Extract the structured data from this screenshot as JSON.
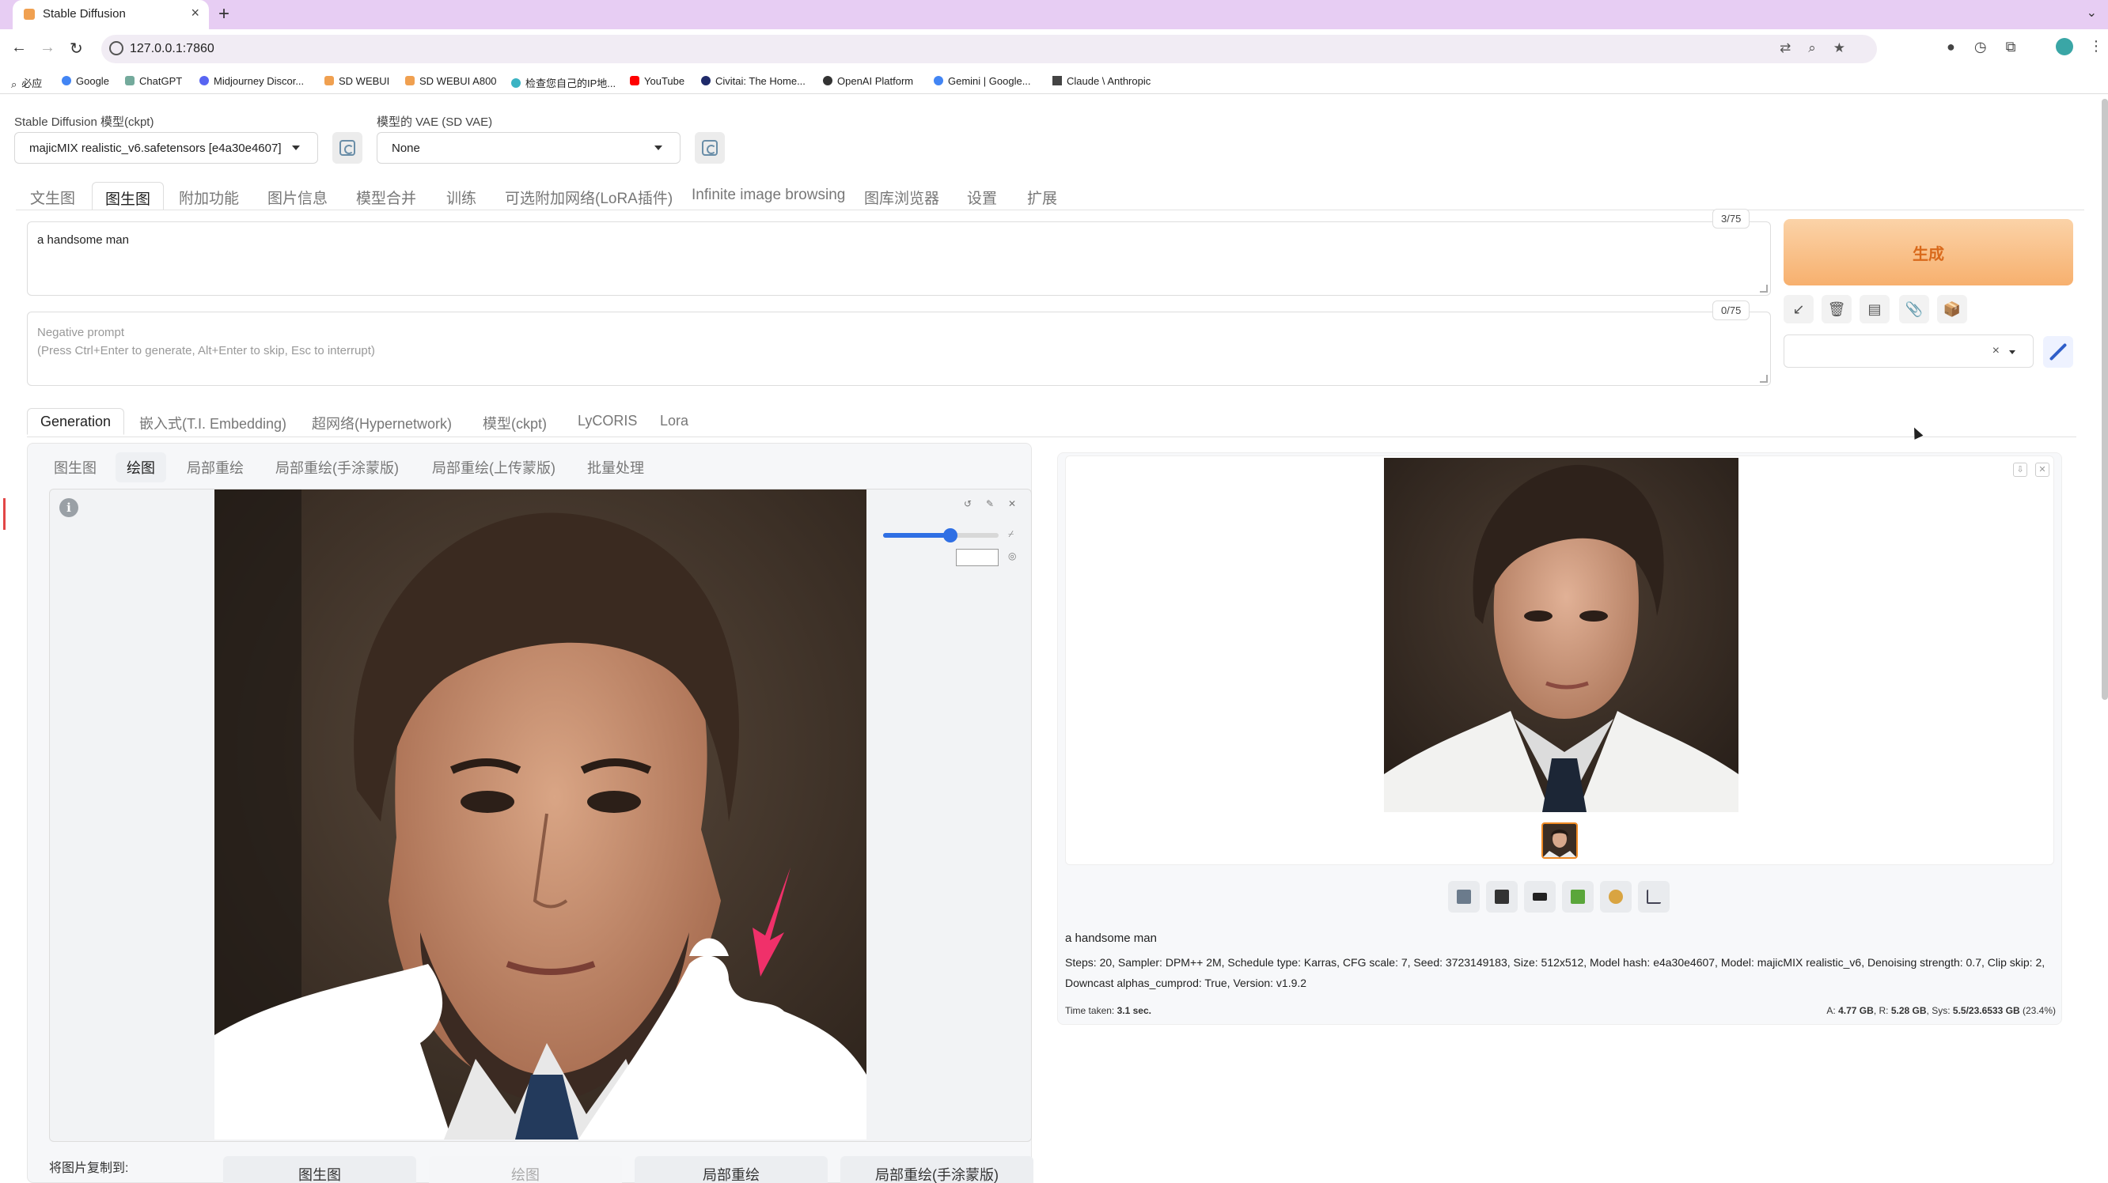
{
  "browser": {
    "tab_title": "Stable Diffusion",
    "url": "127.0.0.1:7860",
    "bookmarks": [
      "必应",
      "Google",
      "ChatGPT",
      "Midjourney Discor...",
      "SD WEBUI",
      "SD WEBUI A800",
      "检查您自己的IP地...",
      "YouTube",
      "Civitai: The Home...",
      "OpenAI Platform",
      "Gemini | Google...",
      "Claude \\ Anthropic"
    ]
  },
  "models": {
    "ckpt_label": "Stable Diffusion 模型(ckpt)",
    "ckpt_value": "majicMIX realistic_v6.safetensors [e4a30e4607]",
    "vae_label": "模型的 VAE (SD VAE)",
    "vae_value": "None"
  },
  "main_tabs": [
    "文生图",
    "图生图",
    "附加功能",
    "图片信息",
    "模型合并",
    "训练",
    "可选附加网络(LoRA插件)",
    "Infinite image browsing",
    "图库浏览器",
    "设置",
    "扩展"
  ],
  "prompt": {
    "positive": "a handsome man",
    "positive_count": "3/75",
    "negative_placeholder": "Negative prompt",
    "negative_hint": "(Press Ctrl+Enter to generate, Alt+Enter to skip, Esc to interrupt)",
    "negative_count": "0/75"
  },
  "generate_label": "生成",
  "extra_tabs": [
    "Generation",
    "嵌入式(T.I. Embedding)",
    "超网络(Hypernetwork)",
    "模型(ckpt)",
    "LyCORIS",
    "Lora"
  ],
  "img2img_tabs": [
    "图生图",
    "绘图",
    "局部重绘",
    "局部重绘(手涂蒙版)",
    "局部重绘(上传蒙版)",
    "批量处理"
  ],
  "brush": {
    "size_fraction": 0.58
  },
  "copy_to": {
    "label": "将图片复制到:",
    "buttons": [
      "图生图",
      "绘图",
      "局部重绘",
      "局部重绘(手涂蒙版)"
    ]
  },
  "output": {
    "prompt": "a handsome man",
    "params": "Steps: 20, Sampler: DPM++ 2M, Schedule type: Karras, CFG scale: 7, Seed: 3723149183, Size: 512x512, Model hash: e4a30e4607, Model: majicMIX realistic_v6, Denoising strength: 0.7, Clip skip: 2, Downcast alphas_cumprod: True, Version: v1.9.2",
    "time_label": "Time taken:",
    "time_value": "3.1 sec.",
    "mem_a_label": "A:",
    "mem_a": "4.77 GB",
    "mem_r_label": "R:",
    "mem_r": "5.28 GB",
    "mem_sys_label": "Sys:",
    "mem_sys": "5.5/23.6533 GB",
    "mem_pct": "(23.4%)"
  },
  "colors": {
    "accent": "#2f6fe4",
    "generate": "#f7b06e",
    "generate_text": "#d9691b",
    "tab_bar": "#e7cdf3",
    "arrow": "#f0306a"
  }
}
